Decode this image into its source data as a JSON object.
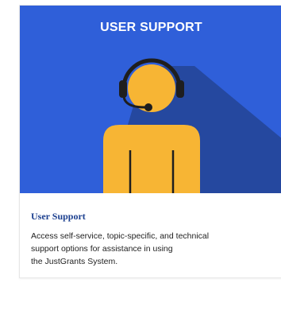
{
  "card": {
    "hero_title": "USER SUPPORT",
    "illustration_icon": "person-with-headset-icon",
    "title": "User Support",
    "description_lines": [
      "Access self-service, topic-specific, and technical",
      "support options for assistance in using",
      "the JustGrants System."
    ]
  },
  "colors": {
    "hero_background": "#2f5fd9",
    "shadow": "#25489f",
    "figure": "#f7b534",
    "headset": "#1e1e1e",
    "title_text": "#1b3f8f"
  }
}
